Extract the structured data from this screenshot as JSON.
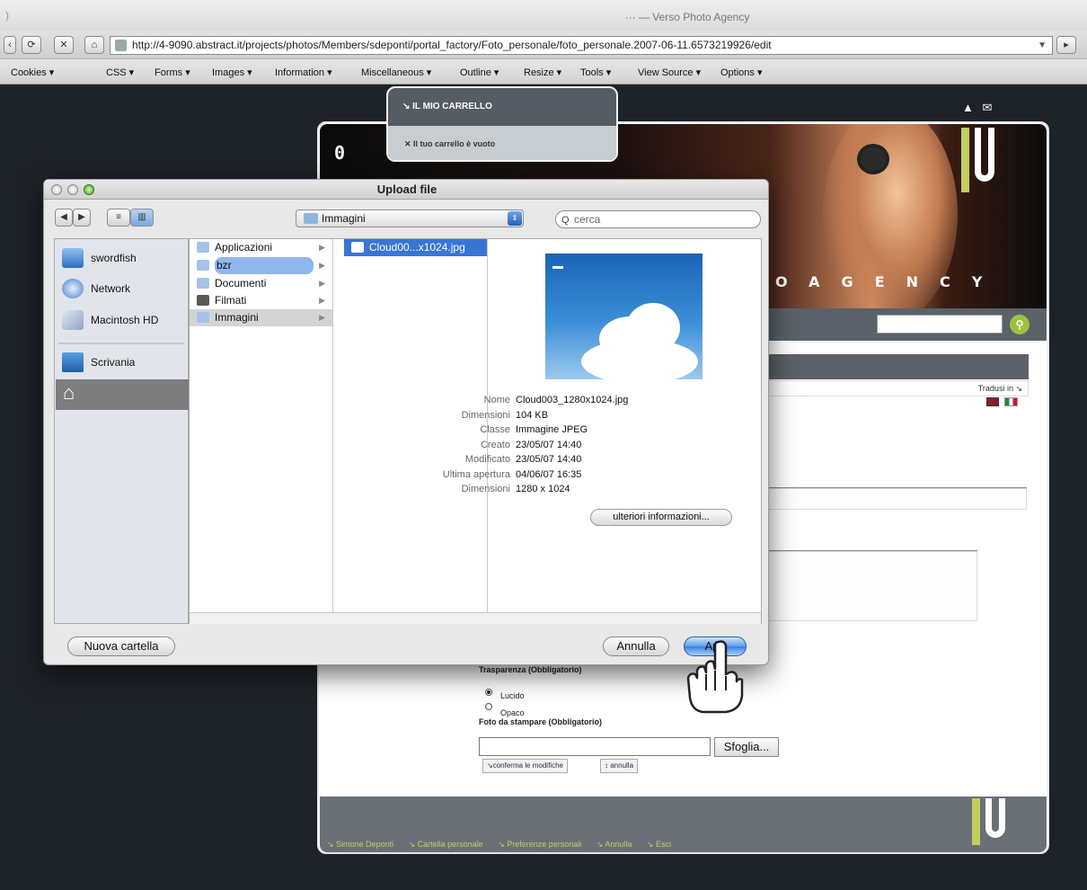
{
  "browser": {
    "window_title": "··· — Verso Photo Agency",
    "url": "http://4-9090.abstract.it/projects/photos/Members/sdeponti/portal_factory/Foto_personale/foto_personale.2007-06-11.6573219926/edit",
    "toolbar": [
      "Cookies ▾",
      "CSS ▾",
      "Forms ▾",
      "Images ▾",
      "Information ▾",
      "Miscellaneous ▾",
      "Outline ▾",
      "Resize ▾",
      "Tools ▾",
      "View Source ▾",
      "Options ▾"
    ]
  },
  "site": {
    "logo_letter": "0",
    "agency": "OAGENCY",
    "cart_title": "↘ IL MIO CARRELLO",
    "cart_empty": "Il tuo carrello è vuoto",
    "translate": "Tradusi in ↘",
    "transparency_label": "Trasparenza (Obbligatorio)",
    "option_glossy": "Lucido",
    "option_matte": "Opaco",
    "photo_label": "Foto da stampare (Obbligatorio)",
    "browse_label": "Sfoglia...",
    "confirm_label": "↘conferma le modifiche",
    "cancel_label": "↕ annulla",
    "footer_links": [
      "↘ Simone Deponti",
      "↘ Cartella personale",
      "↘ Preferenze personali",
      "↘ Annulla",
      "↘ Esci"
    ]
  },
  "dialog": {
    "title": "Upload file",
    "location": "Immagini",
    "search_placeholder": "cerca",
    "sidebar": [
      "swordfish",
      "Network",
      "Macintosh HD",
      "Scrivania"
    ],
    "folders": [
      "Applicazioni",
      "bzr",
      "Documenti",
      "Filmati",
      "Immagini"
    ],
    "selected_file": "Cloud00...x1024.jpg",
    "info": [
      {
        "key": "Nome",
        "value": "Cloud003_1280x1024.jpg"
      },
      {
        "key": "Dimensioni",
        "value": "104 KB"
      },
      {
        "key": "Classe",
        "value": "Immagine JPEG"
      },
      {
        "key": "Creato",
        "value": "23/05/07 14:40"
      },
      {
        "key": "Modificato",
        "value": "23/05/07 14:40"
      },
      {
        "key": "Ultima apertura",
        "value": "04/06/07 16:35"
      },
      {
        "key": "Dimensioni",
        "value": "1280 x 1024"
      }
    ],
    "more_info": "ulteriori informazioni...",
    "new_folder": "Nuova cartella",
    "cancel": "Annulla",
    "open": "Apri"
  }
}
